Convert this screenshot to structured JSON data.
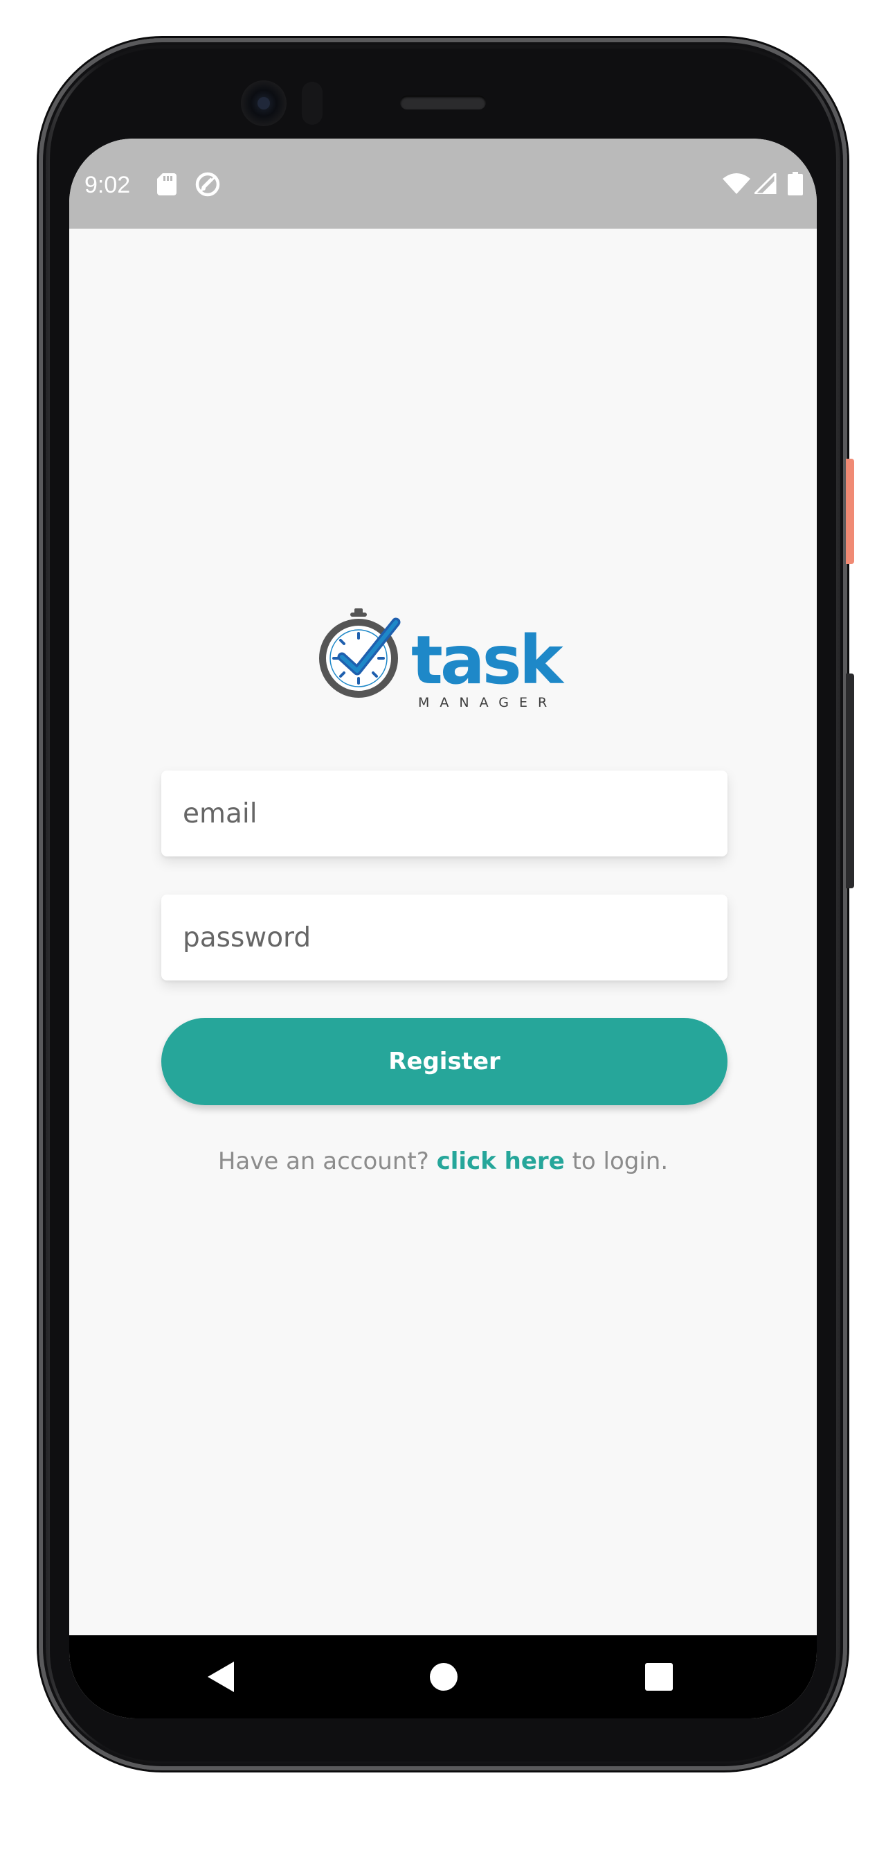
{
  "status_bar": {
    "time": "9:02",
    "icons": [
      "sd-card-icon",
      "sync-off-icon",
      "wifi-icon",
      "cellular-signal-icon",
      "battery-icon"
    ]
  },
  "logo": {
    "word": "task",
    "tagline": "MANAGER",
    "icon": "stopwatch-check-icon",
    "colors": {
      "primary": "#1e88c8",
      "secondary": "#2a3f9a",
      "dial": "#555555"
    }
  },
  "form": {
    "email_placeholder": "email",
    "password_placeholder": "password",
    "register_label": "Register"
  },
  "login_prompt": {
    "prefix": "Have an account?",
    "link": "click here",
    "suffix": "to login."
  },
  "navigation": {
    "buttons": [
      "back-icon",
      "home-icon",
      "recents-icon"
    ]
  },
  "theme": {
    "accent": "#26a69a",
    "background": "#f8f8f8",
    "status_bar": "#bababa"
  }
}
